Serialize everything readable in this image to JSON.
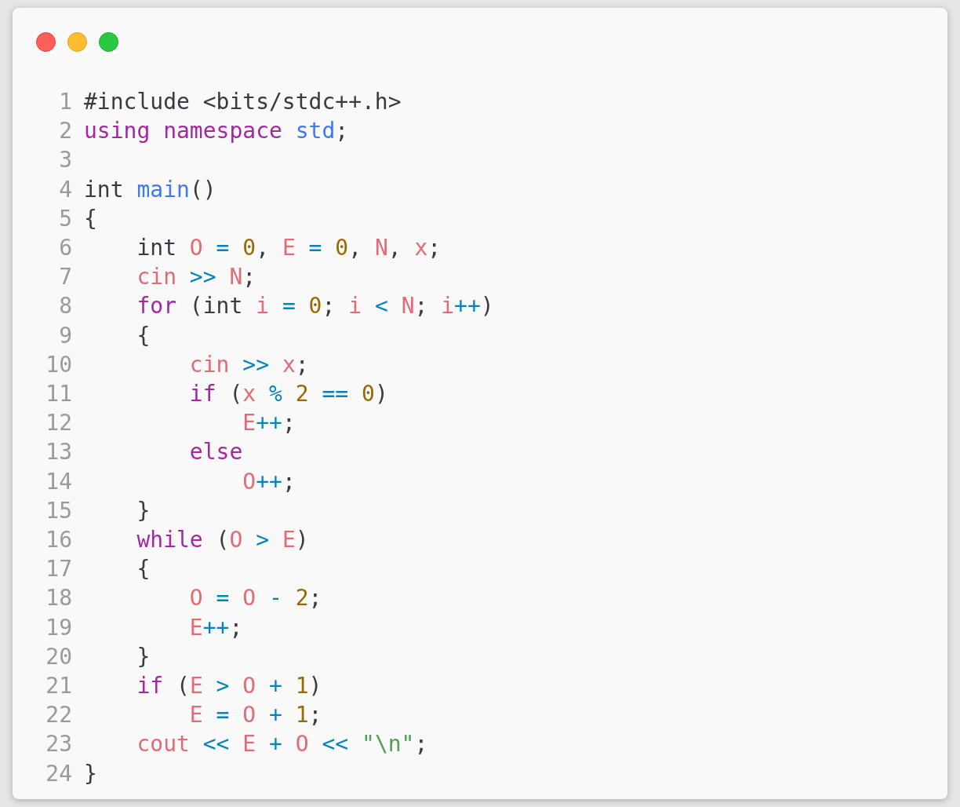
{
  "window": {
    "controls": [
      {
        "kind": "close"
      },
      {
        "kind": "minimize"
      },
      {
        "kind": "maximize"
      }
    ]
  },
  "code": {
    "lines": [
      {
        "number": "1",
        "tokens": [
          {
            "kind": "plain",
            "text": "#include <bits/stdc++.h>"
          }
        ]
      },
      {
        "number": "2",
        "tokens": [
          {
            "kind": "keyword",
            "text": "using namespace "
          },
          {
            "kind": "function",
            "text": "std"
          },
          {
            "kind": "plain",
            "text": ";"
          }
        ]
      },
      {
        "number": "3"
      },
      {
        "number": "4",
        "tokens": [
          {
            "kind": "plain",
            "text": "int "
          },
          {
            "kind": "function",
            "text": "main"
          },
          {
            "kind": "plain",
            "text": "()"
          }
        ]
      },
      {
        "number": "5",
        "tokens": [
          {
            "kind": "plain",
            "text": "{"
          }
        ]
      },
      {
        "number": "6",
        "tokens": [
          {
            "kind": "plain",
            "text": "    int "
          },
          {
            "kind": "variable",
            "text": "O "
          },
          {
            "kind": "operator",
            "text": "= "
          },
          {
            "kind": "number",
            "text": "0"
          },
          {
            "kind": "plain",
            "text": ", "
          },
          {
            "kind": "variable",
            "text": "E "
          },
          {
            "kind": "operator",
            "text": "= "
          },
          {
            "kind": "number",
            "text": "0"
          },
          {
            "kind": "plain",
            "text": ", "
          },
          {
            "kind": "variable",
            "text": "N"
          },
          {
            "kind": "plain",
            "text": ", "
          },
          {
            "kind": "variable",
            "text": "x"
          },
          {
            "kind": "plain",
            "text": ";"
          }
        ]
      },
      {
        "number": "7",
        "tokens": [
          {
            "kind": "variable",
            "text": "    cin "
          },
          {
            "kind": "operator",
            "text": ">> "
          },
          {
            "kind": "variable",
            "text": "N"
          },
          {
            "kind": "plain",
            "text": ";"
          }
        ]
      },
      {
        "number": "8",
        "tokens": [
          {
            "kind": "keyword",
            "text": "    for"
          },
          {
            "kind": "plain",
            "text": " (int "
          },
          {
            "kind": "variable",
            "text": "i "
          },
          {
            "kind": "operator",
            "text": "= "
          },
          {
            "kind": "number",
            "text": "0"
          },
          {
            "kind": "plain",
            "text": "; "
          },
          {
            "kind": "variable",
            "text": "i "
          },
          {
            "kind": "operator",
            "text": "< "
          },
          {
            "kind": "variable",
            "text": "N"
          },
          {
            "kind": "plain",
            "text": "; "
          },
          {
            "kind": "variable",
            "text": "i"
          },
          {
            "kind": "operator",
            "text": "++"
          },
          {
            "kind": "plain",
            "text": ")"
          }
        ]
      },
      {
        "number": "9",
        "tokens": [
          {
            "kind": "plain",
            "text": "    {"
          }
        ]
      },
      {
        "number": "10",
        "tokens": [
          {
            "kind": "variable",
            "text": "        cin "
          },
          {
            "kind": "operator",
            "text": ">> "
          },
          {
            "kind": "variable",
            "text": "x"
          },
          {
            "kind": "plain",
            "text": ";"
          }
        ]
      },
      {
        "number": "11",
        "tokens": [
          {
            "kind": "keyword",
            "text": "        if"
          },
          {
            "kind": "plain",
            "text": " ("
          },
          {
            "kind": "variable",
            "text": "x "
          },
          {
            "kind": "operator",
            "text": "% "
          },
          {
            "kind": "number",
            "text": "2 "
          },
          {
            "kind": "operator",
            "text": "== "
          },
          {
            "kind": "number",
            "text": "0"
          },
          {
            "kind": "plain",
            "text": ")"
          }
        ]
      },
      {
        "number": "12",
        "tokens": [
          {
            "kind": "variable",
            "text": "            E"
          },
          {
            "kind": "operator",
            "text": "++"
          },
          {
            "kind": "plain",
            "text": ";"
          }
        ]
      },
      {
        "number": "13",
        "tokens": [
          {
            "kind": "keyword",
            "text": "        else"
          }
        ]
      },
      {
        "number": "14",
        "tokens": [
          {
            "kind": "variable",
            "text": "            O"
          },
          {
            "kind": "operator",
            "text": "++"
          },
          {
            "kind": "plain",
            "text": ";"
          }
        ]
      },
      {
        "number": "15",
        "tokens": [
          {
            "kind": "plain",
            "text": "    }"
          }
        ]
      },
      {
        "number": "16",
        "tokens": [
          {
            "kind": "keyword",
            "text": "    while"
          },
          {
            "kind": "plain",
            "text": " ("
          },
          {
            "kind": "variable",
            "text": "O "
          },
          {
            "kind": "operator",
            "text": "> "
          },
          {
            "kind": "variable",
            "text": "E"
          },
          {
            "kind": "plain",
            "text": ")"
          }
        ]
      },
      {
        "number": "17",
        "tokens": [
          {
            "kind": "plain",
            "text": "    {"
          }
        ]
      },
      {
        "number": "18",
        "tokens": [
          {
            "kind": "variable",
            "text": "        O "
          },
          {
            "kind": "operator",
            "text": "= "
          },
          {
            "kind": "variable",
            "text": "O "
          },
          {
            "kind": "operator",
            "text": "- "
          },
          {
            "kind": "number",
            "text": "2"
          },
          {
            "kind": "plain",
            "text": ";"
          }
        ]
      },
      {
        "number": "19",
        "tokens": [
          {
            "kind": "variable",
            "text": "        E"
          },
          {
            "kind": "operator",
            "text": "++"
          },
          {
            "kind": "plain",
            "text": ";"
          }
        ]
      },
      {
        "number": "20",
        "tokens": [
          {
            "kind": "plain",
            "text": "    }"
          }
        ]
      },
      {
        "number": "21",
        "tokens": [
          {
            "kind": "keyword",
            "text": "    if"
          },
          {
            "kind": "plain",
            "text": " ("
          },
          {
            "kind": "variable",
            "text": "E "
          },
          {
            "kind": "operator",
            "text": "> "
          },
          {
            "kind": "variable",
            "text": "O "
          },
          {
            "kind": "operator",
            "text": "+ "
          },
          {
            "kind": "number",
            "text": "1"
          },
          {
            "kind": "plain",
            "text": ")"
          }
        ]
      },
      {
        "number": "22",
        "tokens": [
          {
            "kind": "variable",
            "text": "        E "
          },
          {
            "kind": "operator",
            "text": "= "
          },
          {
            "kind": "variable",
            "text": "O "
          },
          {
            "kind": "operator",
            "text": "+ "
          },
          {
            "kind": "number",
            "text": "1"
          },
          {
            "kind": "plain",
            "text": ";"
          }
        ]
      },
      {
        "number": "23",
        "tokens": [
          {
            "kind": "variable",
            "text": "    cout "
          },
          {
            "kind": "operator",
            "text": "<< "
          },
          {
            "kind": "variable",
            "text": "E "
          },
          {
            "kind": "operator",
            "text": "+ "
          },
          {
            "kind": "variable",
            "text": "O "
          },
          {
            "kind": "operator",
            "text": "<< "
          },
          {
            "kind": "string",
            "text": "\"\\n\""
          },
          {
            "kind": "plain",
            "text": ";"
          }
        ]
      },
      {
        "number": "24",
        "tokens": [
          {
            "kind": "plain",
            "text": "}"
          }
        ]
      }
    ]
  }
}
